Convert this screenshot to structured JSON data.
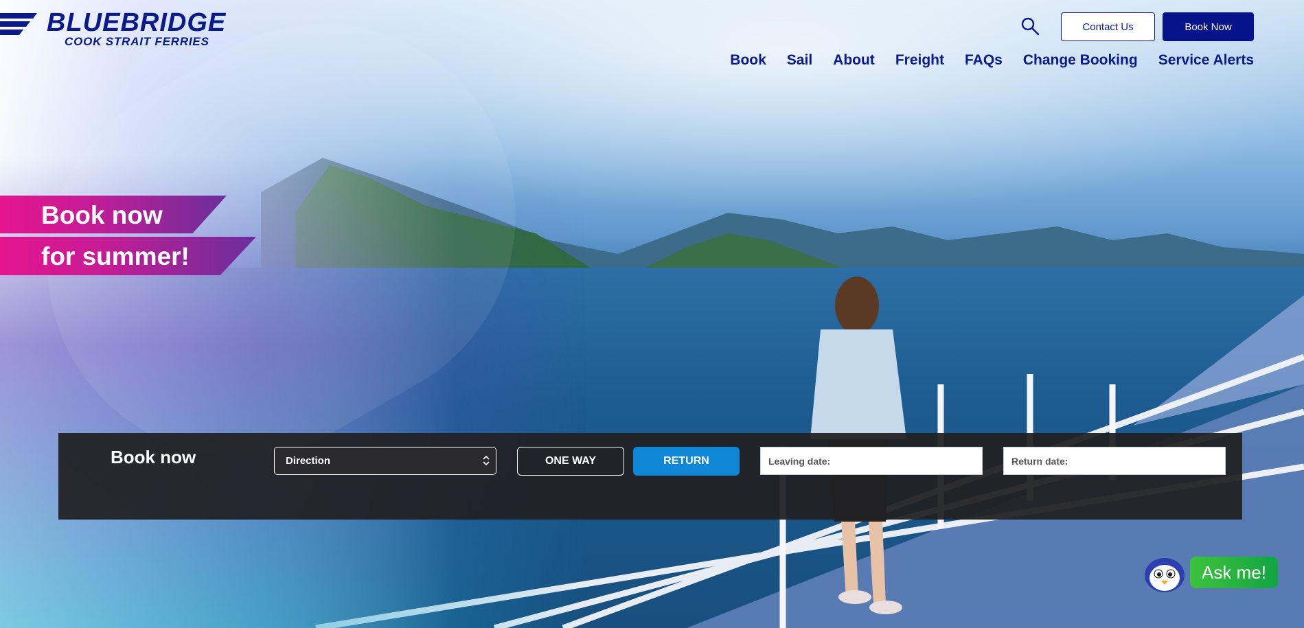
{
  "brand": {
    "name": "BLUEBRIDGE",
    "tagline": "COOK STRAIT FERRIES",
    "color": "#0a1a8a"
  },
  "header": {
    "search_icon": "search-icon",
    "contact_label": "Contact Us",
    "book_now_label": "Book Now"
  },
  "nav": {
    "items": [
      "Book",
      "Sail",
      "About",
      "Freight",
      "FAQs",
      "Change Booking",
      "Service Alerts"
    ]
  },
  "promo": {
    "line1": "Book now",
    "line2": "for summer!",
    "colors": [
      "#e6148f",
      "#6a2f9c"
    ]
  },
  "booking": {
    "title": "Book now",
    "direction_value": "Direction",
    "one_way_label": "ONE WAY",
    "return_label": "RETURN",
    "leaving_placeholder": "Leaving date:",
    "return_placeholder": "Return date:",
    "accent": "#0f86d6"
  },
  "chat": {
    "label": "Ask me!",
    "icon": "penguin-icon"
  }
}
